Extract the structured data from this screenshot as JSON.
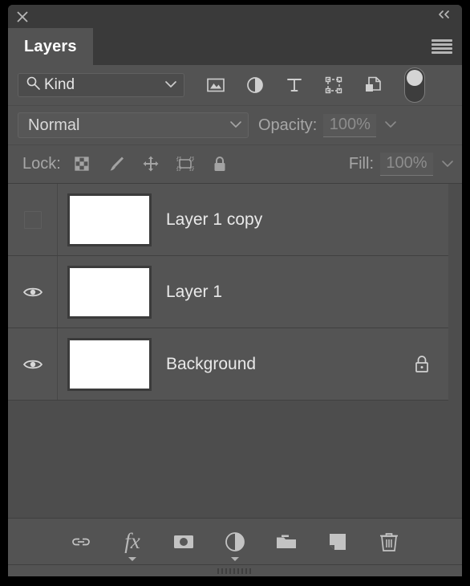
{
  "window": {
    "title": "Layers",
    "close_icon": "close-icon",
    "collapse_icon": "collapse-double-chevron-left",
    "collapse_label": "«",
    "menu_icon": "panel-menu-hamburger-icon"
  },
  "filter_bar": {
    "search_icon": "search-icon",
    "kind_label": "Kind",
    "kind_chevron": "chevron-down-icon",
    "type_filters": [
      {
        "name": "pixel-layer-filter-icon",
        "title": "Filter for pixel layers"
      },
      {
        "name": "adjustment-layer-filter-icon",
        "title": "Filter for adjustment layers"
      },
      {
        "name": "type-layer-filter-icon",
        "title": "Filter for type layers"
      },
      {
        "name": "shape-layer-filter-icon",
        "title": "Filter for shape layers"
      },
      {
        "name": "smart-object-filter-icon",
        "title": "Filter for smart objects"
      }
    ],
    "toggle": {
      "name": "filter-enable-toggle",
      "state": "on"
    }
  },
  "blend_bar": {
    "blend_mode": "Normal",
    "blend_chevron": "chevron-down-icon",
    "opacity_label": "Opacity:",
    "opacity_value": "100%",
    "opacity_chevron": "chevron-down-icon"
  },
  "lock_bar": {
    "lock_label": "Lock:",
    "lock_icons": [
      {
        "name": "lock-transparent-pixels-icon"
      },
      {
        "name": "lock-image-pixels-brush-icon"
      },
      {
        "name": "lock-position-move-icon"
      },
      {
        "name": "lock-artboard-nesting-icon"
      },
      {
        "name": "lock-all-padlock-icon"
      }
    ],
    "fill_label": "Fill:",
    "fill_value": "100%",
    "fill_chevron": "chevron-down-icon"
  },
  "layers": [
    {
      "name": "Layer 1 copy",
      "visible": false,
      "locked": false
    },
    {
      "name": "Layer 1",
      "visible": true,
      "locked": false
    },
    {
      "name": "Background",
      "visible": true,
      "locked": true
    }
  ],
  "bottom_bar": {
    "buttons": [
      {
        "name": "link-layers-button",
        "label": "Link layers",
        "caret": false
      },
      {
        "name": "layer-style-fx-button",
        "label": "fx",
        "caret": true
      },
      {
        "name": "add-layer-mask-button",
        "label": "Add layer mask",
        "caret": false
      },
      {
        "name": "new-adjustment-layer-button",
        "label": "New fill or adjustment layer",
        "caret": true
      },
      {
        "name": "new-group-button",
        "label": "Create a new group",
        "caret": false
      },
      {
        "name": "new-layer-button",
        "label": "Create a new layer",
        "caret": false
      },
      {
        "name": "delete-layer-button",
        "label": "Delete layer",
        "caret": false
      }
    ]
  },
  "colors": {
    "panel_bg": "#535353",
    "header_bg": "#3a3a3a",
    "row_bg": "#545454",
    "list_bg": "#4d4d4d",
    "text": "#e9e9e9",
    "muted_text": "#a7a7a7",
    "disabled_text": "#8d8d8d",
    "thumb": "#ffffff"
  }
}
